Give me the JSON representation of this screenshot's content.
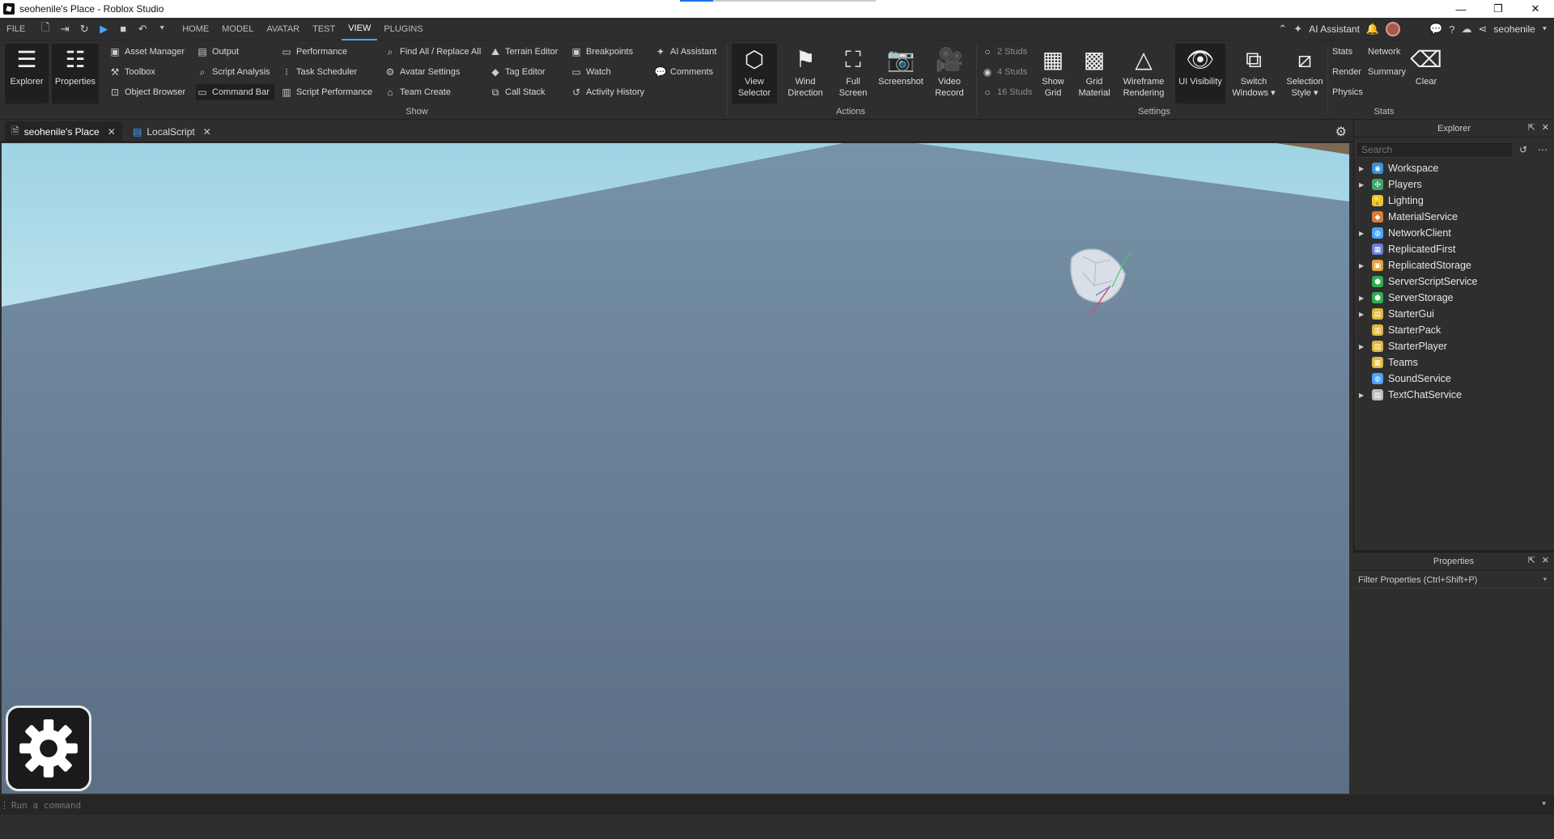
{
  "window": {
    "title": "seohenile's Place - Roblox Studio",
    "progress": 0.17,
    "minimize": "—",
    "restore": "❐",
    "close": "✕"
  },
  "menu": {
    "file": "FILE",
    "tabs": [
      "HOME",
      "MODEL",
      "AVATAR",
      "TEST",
      "VIEW",
      "PLUGINS"
    ],
    "active_tab": "VIEW",
    "ai_assistant": "AI Assistant",
    "username": "seohenile"
  },
  "ribbon": {
    "explorer": "Explorer",
    "properties": "Properties",
    "show": {
      "label": "Show",
      "col1": [
        "Asset Manager",
        "Toolbox",
        "Object Browser"
      ],
      "col2": [
        "Output",
        "Script Analysis",
        "Command Bar"
      ],
      "col3": [
        "Performance",
        "Task Scheduler",
        "Script Performance"
      ],
      "col4": [
        "Find All / Replace All",
        "Avatar Settings",
        "Team Create"
      ],
      "col5": [
        "Terrain Editor",
        "Tag Editor",
        "Call Stack"
      ],
      "col6": [
        "Breakpoints",
        "Watch",
        "Activity History"
      ],
      "col7": [
        "AI Assistant",
        "Comments"
      ]
    },
    "actions": {
      "label": "Actions",
      "view_selector": [
        "View",
        "Selector"
      ],
      "wind_direction": [
        "Wind",
        "Direction"
      ],
      "full_screen": [
        "Full",
        "Screen"
      ],
      "screenshot": "Screenshot",
      "video_record": [
        "Video",
        "Record"
      ]
    },
    "settings": {
      "label": "Settings",
      "studs": [
        "2 Studs",
        "4 Studs",
        "16 Studs"
      ],
      "show_grid": [
        "Show",
        "Grid"
      ],
      "grid_material": [
        "Grid",
        "Material"
      ],
      "wireframe": [
        "Wireframe",
        "Rendering"
      ],
      "ui_visibility": "UI Visibility",
      "switch_windows": [
        "Switch",
        "Windows ▾"
      ],
      "selection_style": [
        "Selection",
        "Style ▾"
      ]
    },
    "stats": {
      "label": "Stats",
      "stats": "Stats",
      "network": "Network",
      "render": "Render",
      "summary": "Summary",
      "physics": "Physics",
      "clear": "Clear"
    }
  },
  "doc_tabs": [
    {
      "label": "seohenile's Place"
    },
    {
      "label": "LocalScript"
    }
  ],
  "explorer": {
    "title": "Explorer",
    "search_placeholder": "Search",
    "items": [
      {
        "label": "Workspace",
        "expandable": true,
        "color": "#3a8fd8"
      },
      {
        "label": "Players",
        "expandable": true,
        "color": "#3aa86b"
      },
      {
        "label": "Lighting",
        "expandable": false,
        "color": "#f1c232"
      },
      {
        "label": "MaterialService",
        "expandable": false,
        "color": "#d77a3a"
      },
      {
        "label": "NetworkClient",
        "expandable": true,
        "color": "#4aa3ff"
      },
      {
        "label": "ReplicatedFirst",
        "expandable": false,
        "color": "#6b7fd8"
      },
      {
        "label": "ReplicatedStorage",
        "expandable": true,
        "color": "#e0a43a"
      },
      {
        "label": "ServerScriptService",
        "expandable": false,
        "color": "#2fae4f"
      },
      {
        "label": "ServerStorage",
        "expandable": true,
        "color": "#2fae4f"
      },
      {
        "label": "StarterGui",
        "expandable": true,
        "color": "#e0b83a"
      },
      {
        "label": "StarterPack",
        "expandable": false,
        "color": "#e0b83a"
      },
      {
        "label": "StarterPlayer",
        "expandable": true,
        "color": "#e0b83a"
      },
      {
        "label": "Teams",
        "expandable": false,
        "color": "#e0b83a"
      },
      {
        "label": "SoundService",
        "expandable": false,
        "color": "#4aa3ff"
      },
      {
        "label": "TextChatService",
        "expandable": true,
        "color": "#bbbbbb"
      }
    ]
  },
  "properties": {
    "title": "Properties",
    "filter_placeholder": "Filter Properties (Ctrl+Shift+P)"
  },
  "command_bar": {
    "placeholder": "Run a command"
  },
  "colors": {
    "accent": "#4aa3ff",
    "panel": "#2e2e2e",
    "baseplate": "#6d8296"
  }
}
